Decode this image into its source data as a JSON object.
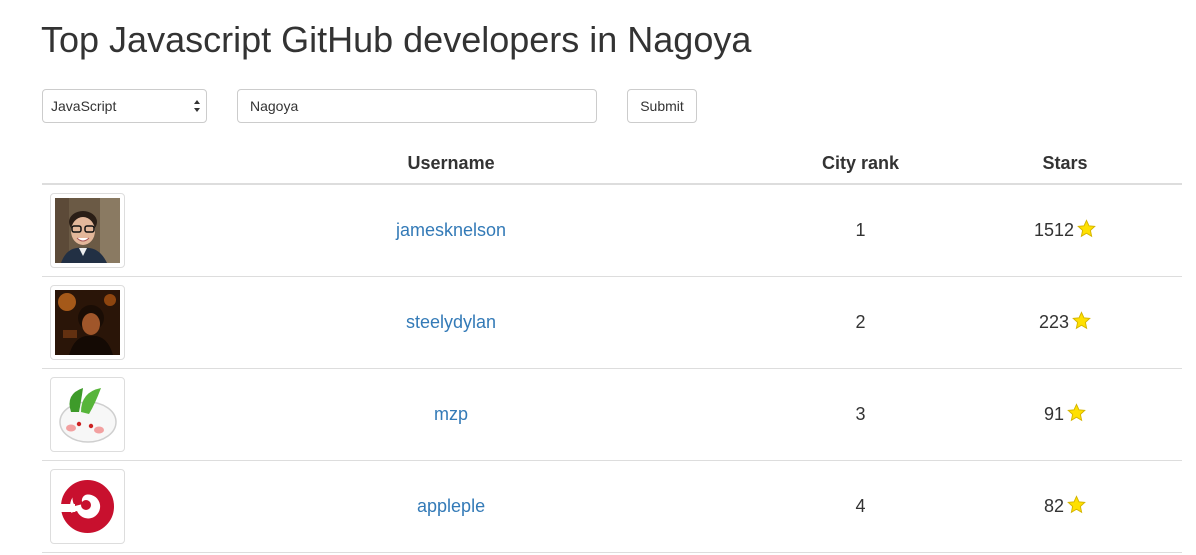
{
  "page": {
    "title": "Top Javascript GitHub developers in Nagoya"
  },
  "form": {
    "language_select_value": "JavaScript",
    "city_input_value": "Nagoya",
    "submit_label": "Submit"
  },
  "table": {
    "headers": {
      "username": "Username",
      "city_rank": "City rank",
      "stars": "Stars"
    },
    "rows": [
      {
        "username": "jamesknelson",
        "city_rank": "1",
        "stars": "1512",
        "avatar_icon": "photo-avatar-icon"
      },
      {
        "username": "steelydylan",
        "city_rank": "2",
        "stars": "223",
        "avatar_icon": "photo-avatar-icon"
      },
      {
        "username": "mzp",
        "city_rank": "3",
        "stars": "91",
        "avatar_icon": "snow-bunny-avatar-icon"
      },
      {
        "username": "appleple",
        "city_rank": "4",
        "stars": "82",
        "avatar_icon": "red-spiral-logo-icon"
      }
    ]
  },
  "colors": {
    "link": "#337ab7",
    "star": "#ffe000",
    "text": "#333333",
    "border": "#dddddd"
  }
}
